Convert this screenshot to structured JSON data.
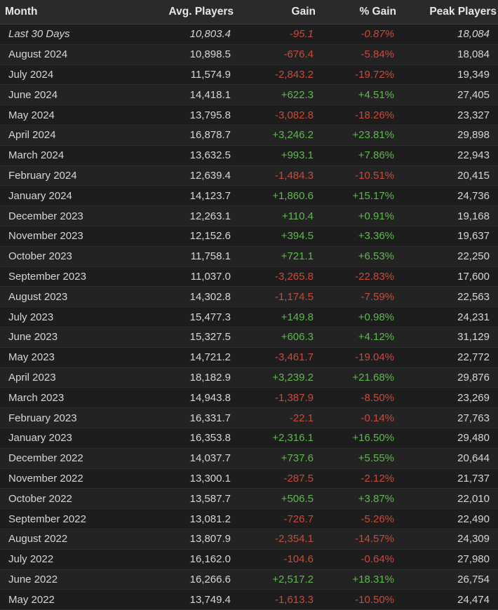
{
  "headers": {
    "month": "Month",
    "avg": "Avg. Players",
    "gain": "Gain",
    "pct": "% Gain",
    "peak": "Peak Players"
  },
  "colors": {
    "negative": "#c94a3a",
    "positive": "#5fb84f"
  },
  "rows": [
    {
      "month": "Last 30 Days",
      "avg": "10,803.4",
      "gain": "-95.1",
      "pct": "-0.87%",
      "peak": "18,084",
      "italic": true
    },
    {
      "month": "August 2024",
      "avg": "10,898.5",
      "gain": "-676.4",
      "pct": "-5.84%",
      "peak": "18,084"
    },
    {
      "month": "July 2024",
      "avg": "11,574.9",
      "gain": "-2,843.2",
      "pct": "-19.72%",
      "peak": "19,349"
    },
    {
      "month": "June 2024",
      "avg": "14,418.1",
      "gain": "+622.3",
      "pct": "+4.51%",
      "peak": "27,405"
    },
    {
      "month": "May 2024",
      "avg": "13,795.8",
      "gain": "-3,082.8",
      "pct": "-18.26%",
      "peak": "23,327"
    },
    {
      "month": "April 2024",
      "avg": "16,878.7",
      "gain": "+3,246.2",
      "pct": "+23.81%",
      "peak": "29,898"
    },
    {
      "month": "March 2024",
      "avg": "13,632.5",
      "gain": "+993.1",
      "pct": "+7.86%",
      "peak": "22,943"
    },
    {
      "month": "February 2024",
      "avg": "12,639.4",
      "gain": "-1,484.3",
      "pct": "-10.51%",
      "peak": "20,415"
    },
    {
      "month": "January 2024",
      "avg": "14,123.7",
      "gain": "+1,860.6",
      "pct": "+15.17%",
      "peak": "24,736"
    },
    {
      "month": "December 2023",
      "avg": "12,263.1",
      "gain": "+110.4",
      "pct": "+0.91%",
      "peak": "19,168"
    },
    {
      "month": "November 2023",
      "avg": "12,152.6",
      "gain": "+394.5",
      "pct": "+3.36%",
      "peak": "19,637"
    },
    {
      "month": "October 2023",
      "avg": "11,758.1",
      "gain": "+721.1",
      "pct": "+6.53%",
      "peak": "22,250"
    },
    {
      "month": "September 2023",
      "avg": "11,037.0",
      "gain": "-3,265.8",
      "pct": "-22.83%",
      "peak": "17,600"
    },
    {
      "month": "August 2023",
      "avg": "14,302.8",
      "gain": "-1,174.5",
      "pct": "-7.59%",
      "peak": "22,563"
    },
    {
      "month": "July 2023",
      "avg": "15,477.3",
      "gain": "+149.8",
      "pct": "+0.98%",
      "peak": "24,231"
    },
    {
      "month": "June 2023",
      "avg": "15,327.5",
      "gain": "+606.3",
      "pct": "+4.12%",
      "peak": "31,129"
    },
    {
      "month": "May 2023",
      "avg": "14,721.2",
      "gain": "-3,461.7",
      "pct": "-19.04%",
      "peak": "22,772"
    },
    {
      "month": "April 2023",
      "avg": "18,182.9",
      "gain": "+3,239.2",
      "pct": "+21.68%",
      "peak": "29,876"
    },
    {
      "month": "March 2023",
      "avg": "14,943.8",
      "gain": "-1,387.9",
      "pct": "-8.50%",
      "peak": "23,269"
    },
    {
      "month": "February 2023",
      "avg": "16,331.7",
      "gain": "-22.1",
      "pct": "-0.14%",
      "peak": "27,763"
    },
    {
      "month": "January 2023",
      "avg": "16,353.8",
      "gain": "+2,316.1",
      "pct": "+16.50%",
      "peak": "29,480"
    },
    {
      "month": "December 2022",
      "avg": "14,037.7",
      "gain": "+737.6",
      "pct": "+5.55%",
      "peak": "20,644"
    },
    {
      "month": "November 2022",
      "avg": "13,300.1",
      "gain": "-287.5",
      "pct": "-2.12%",
      "peak": "21,737"
    },
    {
      "month": "October 2022",
      "avg": "13,587.7",
      "gain": "+506.5",
      "pct": "+3.87%",
      "peak": "22,010"
    },
    {
      "month": "September 2022",
      "avg": "13,081.2",
      "gain": "-726.7",
      "pct": "-5.26%",
      "peak": "22,490"
    },
    {
      "month": "August 2022",
      "avg": "13,807.9",
      "gain": "-2,354.1",
      "pct": "-14.57%",
      "peak": "24,309"
    },
    {
      "month": "July 2022",
      "avg": "16,162.0",
      "gain": "-104.6",
      "pct": "-0.64%",
      "peak": "27,980"
    },
    {
      "month": "June 2022",
      "avg": "16,266.6",
      "gain": "+2,517.2",
      "pct": "+18.31%",
      "peak": "26,754"
    },
    {
      "month": "May 2022",
      "avg": "13,749.4",
      "gain": "-1,613.3",
      "pct": "-10.50%",
      "peak": "24,474"
    }
  ]
}
